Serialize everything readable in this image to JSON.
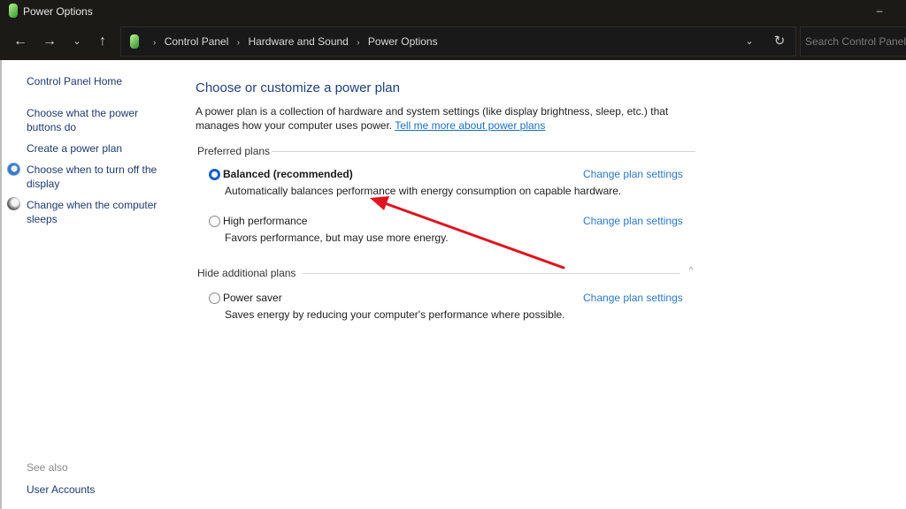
{
  "window": {
    "title": "Power Options",
    "minimize_glyph": "–"
  },
  "nav": {
    "back_glyph": "←",
    "forward_glyph": "→",
    "recent_glyph": "⌄",
    "up_glyph": "↑"
  },
  "address": {
    "crumbs": [
      "Control Panel",
      "Hardware and Sound",
      "Power Options"
    ],
    "separator": "›",
    "dropdown_glyph": "⌄",
    "refresh_glyph": "↻"
  },
  "search": {
    "placeholder": "Search Control Panel",
    "value": ""
  },
  "sidebar": {
    "home": "Control Panel Home",
    "links": [
      {
        "label": "Choose what the power buttons do",
        "icon": null
      },
      {
        "label": "Create a power plan",
        "icon": null
      },
      {
        "label": "Choose when to turn off the display",
        "icon": "display-icon"
      },
      {
        "label": "Change when the computer sleeps",
        "icon": "sleep-icon"
      }
    ],
    "see_also_label": "See also",
    "see_also_links": [
      "User Accounts"
    ]
  },
  "main": {
    "title": "Choose or customize a power plan",
    "intro_text": "A power plan is a collection of hardware and system settings (like display brightness, sleep, etc.) that manages how your computer uses power.",
    "intro_link": "Tell me more about power plans",
    "preferred_header": "Preferred plans",
    "additional_header": "Hide additional plans",
    "collapse_glyph": "^",
    "plans": [
      {
        "name": "Balanced (recommended)",
        "description": "Automatically balances performance with energy consumption on capable hardware.",
        "selected": true,
        "link": "Change plan settings"
      },
      {
        "name": "High performance",
        "description": "Favors performance, but may use more energy.",
        "selected": false,
        "link": "Change plan settings"
      },
      {
        "name": "Power saver",
        "description": "Saves energy by reducing your computer's performance where possible.",
        "selected": false,
        "link": "Change plan settings"
      }
    ]
  },
  "annotation": {
    "arrow_color": "#e0141e"
  }
}
